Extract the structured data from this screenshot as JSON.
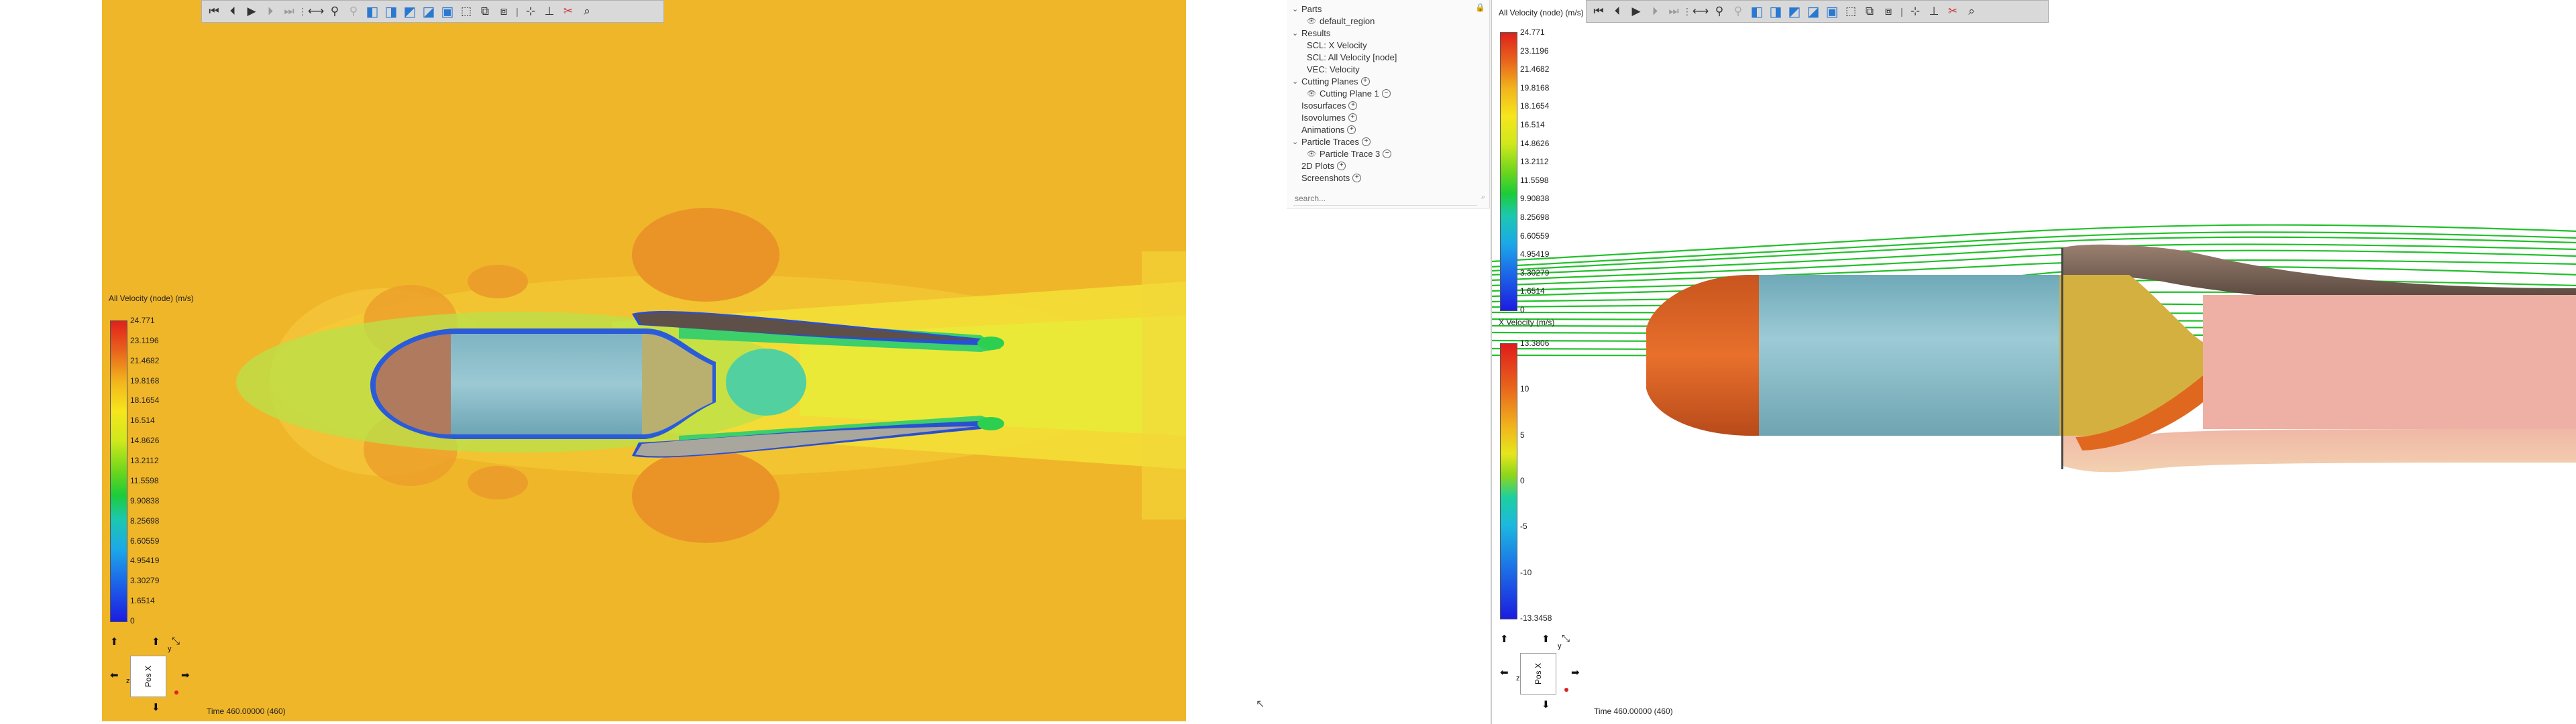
{
  "toolbar": {
    "icons": [
      "first-frame-icon",
      "prev-frame-icon",
      "play-icon",
      "next-frame-icon",
      "last-frame-icon",
      "more-icon",
      "pan-icon",
      "walk-icon",
      "disabled-walk-icon",
      "cube-view-1-icon",
      "cube-view-2-icon",
      "cube-view-3-icon",
      "cube-view-4-icon",
      "cube-view-5-icon",
      "wireframe-icon",
      "wireframe-2-icon",
      "wireframe-3-icon",
      "probe-icon",
      "axis-icon",
      "tools-icon"
    ]
  },
  "left_view": {
    "legend": {
      "title": "All Velocity (node) (m/s)",
      "labels": [
        "24.771",
        "23.1196",
        "21.4682",
        "19.8168",
        "18.1654",
        "16.514",
        "14.8626",
        "13.2112",
        "11.5598",
        "9.90838",
        "8.25698",
        "6.60559",
        "4.95419",
        "3.30279",
        "1.6514",
        "0"
      ]
    },
    "axes": {
      "face_label": "Pos X",
      "y_label": "y",
      "z_label": "z"
    },
    "time": "Time 460.00000 (460)"
  },
  "tree": {
    "items": [
      {
        "label": "Parts",
        "kind": "group"
      },
      {
        "label": "default_region",
        "kind": "child-eye"
      },
      {
        "label": "Results",
        "kind": "group"
      },
      {
        "label": "SCL: X Velocity",
        "kind": "child"
      },
      {
        "label": "SCL: All Velocity [node]",
        "kind": "child"
      },
      {
        "label": "VEC: Velocity",
        "kind": "child"
      },
      {
        "label": "Cutting Planes",
        "kind": "group-plus"
      },
      {
        "label": "Cutting Plane 1",
        "kind": "child-eye-minus"
      },
      {
        "label": "Isosurfaces",
        "kind": "plus"
      },
      {
        "label": "Isovolumes",
        "kind": "plus"
      },
      {
        "label": "Animations",
        "kind": "plus"
      },
      {
        "label": "Particle Traces",
        "kind": "group-plus"
      },
      {
        "label": "Particle Trace 3",
        "kind": "child-eye-minus"
      },
      {
        "label": "2D Plots",
        "kind": "plus"
      },
      {
        "label": "Screenshots",
        "kind": "plus"
      }
    ],
    "search_placeholder": "search..."
  },
  "right_view": {
    "legend_velocity": {
      "title": "All Velocity (node) (m/s)",
      "labels": [
        "24.771",
        "23.1196",
        "21.4682",
        "19.8168",
        "18.1654",
        "16.514",
        "14.8626",
        "13.2112",
        "11.5598",
        "9.90838",
        "8.25698",
        "6.60559",
        "4.95419",
        "3.30279",
        "1.6514",
        "0"
      ]
    },
    "legend_x": {
      "title": "X Velocity (m/s)",
      "labels": [
        "13.3806",
        "10",
        "5",
        "0",
        "-5",
        "-10",
        "-13.3458"
      ]
    },
    "axes": {
      "face_label": "Pos X",
      "y_label": "y",
      "z_label": "z"
    },
    "time": "Time 460.00000 (460)"
  },
  "colors": {
    "background_field": "#f0b62a",
    "body_cyan": "#8fc3cf",
    "nose_left": "#b07a5e",
    "nose_right": "#e06a2a",
    "streamline": "#22c02a"
  }
}
